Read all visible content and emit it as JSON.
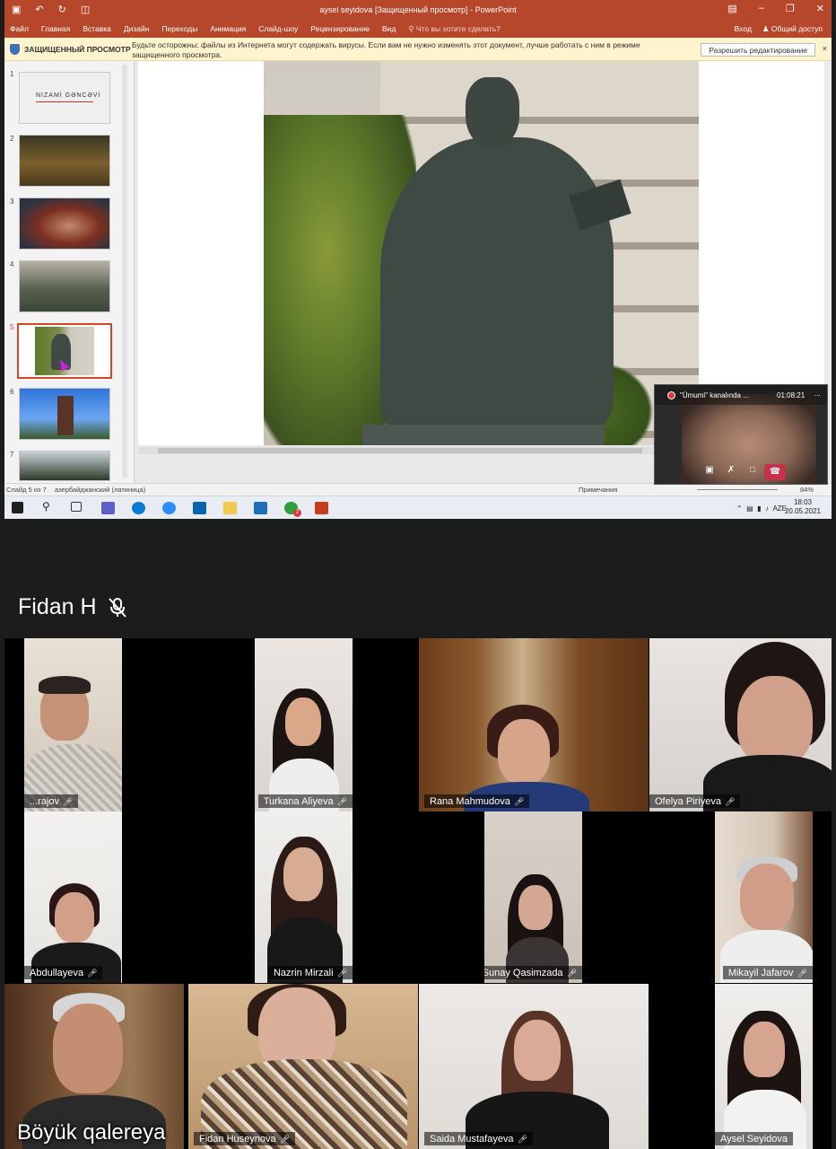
{
  "powerpoint": {
    "title": "aysel seyidova [Защищенный просмотр] - PowerPoint",
    "qat_icons": [
      "save-icon",
      "undo-icon",
      "redo-icon",
      "slideshow-icon"
    ],
    "window_buttons": [
      "ribbon-display-icon",
      "minimize-icon",
      "maximize-icon",
      "close-icon"
    ],
    "ribbon_tabs": [
      "Файл",
      "Главная",
      "Вставка",
      "Дизайн",
      "Переходы",
      "Анимация",
      "Слайд-шоу",
      "Рецензирование",
      "Вид"
    ],
    "tell_me": "Что вы хотите сделать?",
    "signin": "Вход",
    "share": "Общий доступ",
    "protected_view": {
      "title": "ЗАЩИЩЕННЫЙ ПРОСМОТР",
      "message": "Будьте осторожны: файлы из Интернета могут содержать вирусы. Если вам не нужно изменять этот документ, лучше работать с ним в режиме защищенного просмотра.",
      "button": "Разрешить редактирование",
      "close": "×"
    },
    "slides": [
      {
        "num": "1",
        "caption": "NIZAMİ GƏNCƏVİ"
      },
      {
        "num": "2",
        "caption": ""
      },
      {
        "num": "3",
        "caption": ""
      },
      {
        "num": "4",
        "caption": ""
      },
      {
        "num": "5",
        "caption": "",
        "selected": true
      },
      {
        "num": "6",
        "caption": ""
      },
      {
        "num": "7",
        "caption": ""
      }
    ],
    "statusbar": {
      "slide_info": "Слайд 5 из 7",
      "language": "азербайджанский (латиница)",
      "notes": "Примечания",
      "zoom": "84%"
    }
  },
  "taskbar": {
    "icons": [
      "windows-start-icon",
      "search-icon",
      "task-view-icon",
      "teams-icon",
      "edge-icon",
      "zoom-icon",
      "mail-icon",
      "file-explorer-icon",
      "photos-icon",
      "chat-icon",
      "powerpoint-icon"
    ],
    "chat_badge": "2",
    "language": "AZE",
    "time": "18:03",
    "date": "20.05.2021"
  },
  "call_pip": {
    "channel": "\"Ümumi\" kanalında ...",
    "timer": "01:08:21",
    "more": "...",
    "controls": [
      "camera-icon",
      "mic-off-icon",
      "share-screen-icon",
      "hang-up-icon"
    ]
  },
  "presenter": {
    "name": "Fidan H"
  },
  "participants": [
    {
      "name": "...rajov"
    },
    {
      "name": "Turkana Aliyeva"
    },
    {
      "name": "Rana Mahmudova"
    },
    {
      "name": "Ofelya Piriyeva"
    },
    {
      "name": "Abdullayeva"
    },
    {
      "name": "Nazrin Mirzali"
    },
    {
      "name": "Sunay Qasimzada"
    },
    {
      "name": "Mikayil Jafarov"
    },
    {
      "name": ""
    },
    {
      "name": "Fidan Huseynova"
    },
    {
      "name": "Saida Mustafayeva"
    },
    {
      "name": "Aysel Seyidova"
    }
  ],
  "gallery_label": "Böyük qalereya",
  "colors": {
    "ppt_accent": "#b7472a",
    "hangup": "#c4314b",
    "app_bg": "#1c1c1c"
  }
}
